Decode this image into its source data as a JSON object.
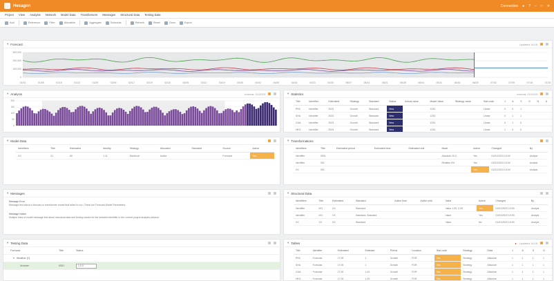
{
  "app": {
    "title": "Hexagon",
    "user": "Connection"
  },
  "menu": [
    "Project",
    "View",
    "Analysis",
    "Network",
    "Model Data",
    "Transformers",
    "Messages",
    "Structural Data",
    "Testing Data"
  ],
  "toolbar": [
    {
      "label": "Add",
      "icon": "add-icon"
    },
    {
      "label": "Reference",
      "icon": "reference-icon"
    },
    {
      "label": "Filter",
      "icon": "filter-icon"
    },
    {
      "label": "Allocation",
      "icon": "allocation-icon"
    },
    {
      "label": "Aggregate",
      "icon": "aggregate-icon"
    },
    {
      "label": "Schedule",
      "icon": "schedule-icon"
    },
    {
      "label": "Refresh",
      "icon": "refresh-icon"
    },
    {
      "label": "Reset",
      "icon": "reset-icon"
    },
    {
      "label": "Clear",
      "icon": "clear-icon"
    },
    {
      "label": "Export",
      "icon": "export-icon"
    }
  ],
  "panels": {
    "forecast": {
      "title": "Forecast",
      "right_label": "Updated 14:05",
      "y_ticks": [
        "300,000",
        "200,000",
        "100,000",
        "0"
      ],
      "x_ticks": [
        "01/01",
        "01/08",
        "01/15",
        "01/22",
        "01/29",
        "02/05",
        "02/12",
        "02/19",
        "02/26",
        "03/05",
        "03/12",
        "03/19",
        "03/26",
        "04/02",
        "04/09",
        "04/16",
        "04/23",
        "04/30",
        "05/07",
        "05/14",
        "05/21",
        "05/28",
        "06/04",
        "06/11",
        "06/18",
        "06/25",
        "07/02",
        "07/09",
        "07/16",
        "07/23"
      ]
    },
    "analysis": {
      "title": "Analysis",
      "right_label": "Interval: 01/2023",
      "y_ticks": [
        "200",
        "150",
        "100",
        "50",
        "0"
      ]
    },
    "model_data": {
      "title": "Model Data",
      "columns": [
        "Identifiers",
        "Title",
        "Estimated",
        "Identity",
        "Strategy",
        "Allocated",
        "Standard",
        "Source",
        "Active"
      ],
      "rows": [
        [
          "XX",
          "01",
          "60",
          "1.11",
          "Electrical",
          "Active",
          "",
          "Forecast",
          "Yes"
        ]
      ]
    },
    "messages": {
      "title": "Messages",
      "items": [
        {
          "title": "Message Error",
          "text": "Message text about a forecast or transformer model that failed to run. Check the Forecast Model Parameters."
        },
        {
          "title": "Message Notice",
          "text": "Multiple lines of model message text about structural data and testing values for the selected identifier in the current project analysis window."
        }
      ]
    },
    "testing_data": {
      "title": "Testing Data",
      "columns": [
        "Forecast",
        "Title",
        "Status"
      ],
      "group_label": "Weather (2)",
      "rows": [
        [
          "Number",
          "0001",
          "1.0.0"
        ]
      ]
    },
    "statistics": {
      "title": "Statistics",
      "right_label": "Interval: 01/2023",
      "columns": [
        "Title",
        "Identifier",
        "Estimated",
        "Strategy",
        "Standard",
        "Status",
        "Actual value",
        "Model Value",
        "Strategy value",
        "Stat code",
        "J",
        "A",
        "S",
        "O",
        "N",
        "D"
      ],
      "rows": [
        [
          "PEK",
          "Identifier",
          "2023",
          "Growth",
          "Standard",
          "New",
          "",
          "1234",
          "",
          "Linear",
          "0",
          "0",
          "1",
          "",
          "",
          ""
        ],
        [
          "SHA",
          "Identifier",
          "2023",
          "Growth",
          "Standard",
          "New",
          "",
          "1234",
          "",
          "Linear",
          "0",
          "1",
          "1",
          "",
          "",
          ""
        ],
        [
          "CAN",
          "Identifier",
          "2023",
          "Growth",
          "Standard",
          "New",
          "",
          "1234",
          "",
          "Linear",
          "0",
          "1",
          "0",
          "",
          "",
          ""
        ],
        [
          "HKG",
          "Identifier",
          "2023",
          "Growth",
          "Standard",
          "New",
          "",
          "1234",
          "",
          "Linear",
          "1",
          "0",
          "0",
          "",
          "",
          ""
        ]
      ]
    },
    "transformations": {
      "title": "Transformations",
      "columns": [
        "Identifiers",
        "Title",
        "Estimated period",
        "Estimated time",
        "Estimated unit",
        "Mode",
        "Active",
        "Changed",
        "By"
      ],
      "rows": [
        [
          "Identifier",
          "0001",
          "",
          "",
          "",
          "Absolute 20.0",
          "Yes",
          "01/01/2023 10:00",
          "Analyst"
        ],
        [
          "Identifier",
          "001",
          "",
          "",
          "",
          "Relative 0%",
          "Yes",
          "01/01/2023 10:00",
          "Analyst"
        ],
        [
          "XX",
          "001",
          "",
          "",
          "",
          "",
          "Yes",
          "01/01/2023 10:00",
          "Analyst"
        ]
      ]
    },
    "structural": {
      "title": "Structural Data",
      "columns": [
        "Identifiers",
        "Title",
        "Estimated",
        "Standard",
        "Active from",
        "Active until",
        "Value",
        "Active",
        "Changed",
        "By"
      ],
      "rows": [
        [
          "Identifier",
          "001",
          "XX",
          "Standard",
          "",
          "",
          "Value 1.00, 0.00",
          "Yes",
          "01/01/2023 10:00",
          "Analyst"
        ],
        [
          "Identifier",
          "001",
          "XX",
          "Standard, Standard",
          "",
          "",
          "Value",
          "Yes",
          "01/01/2023 10:00",
          "Analyst"
        ],
        [
          "XX",
          "XX",
          "XX",
          "Standard",
          "",
          "",
          "Value",
          "No",
          "01/01/2023 10:00",
          "Analyst"
        ]
      ]
    },
    "tables": {
      "title": "Tables",
      "right_label": "Updated 14:05",
      "columns": [
        "Title",
        "Identifier",
        "Estimated",
        "Estimate",
        "Period",
        "Location",
        "Stat code",
        "Strategy",
        "Data",
        "J",
        "A",
        "S",
        "O"
      ],
      "rows": [
        [
          "PEK",
          "Forecast",
          "17.00",
          "1",
          "Growth",
          "FOR",
          "Yes",
          "Strategy",
          "Absolute",
          "1",
          "1",
          "1",
          "1"
        ],
        [
          "SHA",
          "Forecast",
          "17.00",
          "1",
          "Growth",
          "FOR",
          "Yes",
          "Strategy",
          "Absolute",
          "1",
          "1",
          "1",
          "1"
        ],
        [
          "CAN",
          "Forecast",
          "17.00",
          "1.00",
          "Growth",
          "FOR",
          "Yes",
          "Strategy",
          "Absolute",
          "1",
          "1",
          "1",
          "1"
        ],
        [
          "HKG",
          "Forecast",
          "17.00",
          "1.00",
          "Growth",
          "FOR",
          "Yes",
          "Strategy",
          "Absolute",
          "1",
          "1",
          "1",
          "1"
        ]
      ]
    }
  },
  "colors": {
    "accent": "#f08a24",
    "highlight": "#f6b24a",
    "navy": "#2c2f6b",
    "purple": "#7a4a9a",
    "green_line": "#4aa04a",
    "red_line": "#c04050",
    "blue_line": "#3070b0"
  }
}
